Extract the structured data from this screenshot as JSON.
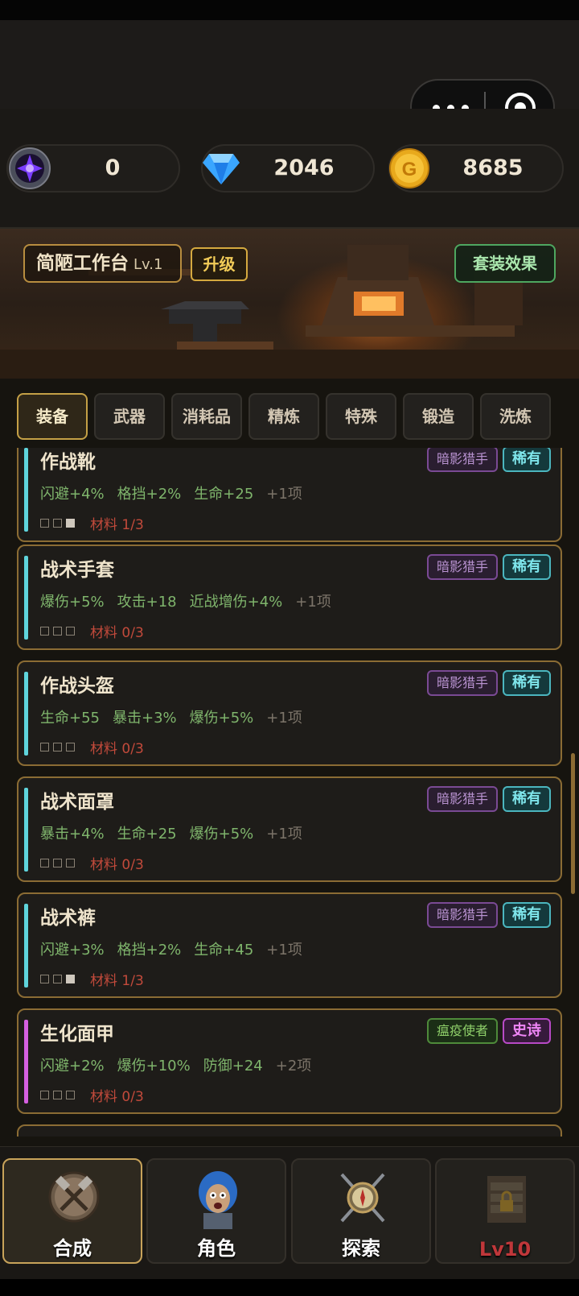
{
  "resources": [
    {
      "icon": "dark-crystal-icon",
      "value": "0"
    },
    {
      "icon": "diamond-icon",
      "value": "2046"
    },
    {
      "icon": "gold-coin-icon",
      "value": "8685"
    }
  ],
  "workbench": {
    "title": "简陋工作台",
    "level": "Lv.1",
    "upgrade": "升级",
    "set_effect": "套装效果"
  },
  "tabs": [
    "装备",
    "武器",
    "消耗品",
    "精炼",
    "特殊",
    "锻造",
    "洗炼"
  ],
  "items": [
    {
      "name": "作战靴",
      "stats": [
        "闪避+4%",
        "格挡+2%",
        "生命+25"
      ],
      "more": "+1项",
      "material": "材料 1/3",
      "filled": 1,
      "class": "暗影猎手",
      "rarity": "稀有"
    },
    {
      "name": "战术手套",
      "stats": [
        "爆伤+5%",
        "攻击+18",
        "近战增伤+4%"
      ],
      "more": "+1项",
      "material": "材料 0/3",
      "filled": 0,
      "class": "暗影猎手",
      "rarity": "稀有"
    },
    {
      "name": "作战头盔",
      "stats": [
        "生命+55",
        "暴击+3%",
        "爆伤+5%"
      ],
      "more": "+1项",
      "material": "材料 0/3",
      "filled": 0,
      "class": "暗影猎手",
      "rarity": "稀有"
    },
    {
      "name": "战术面罩",
      "stats": [
        "暴击+4%",
        "生命+25",
        "爆伤+5%"
      ],
      "more": "+1项",
      "material": "材料 0/3",
      "filled": 0,
      "class": "暗影猎手",
      "rarity": "稀有"
    },
    {
      "name": "战术裤",
      "stats": [
        "闪避+3%",
        "格挡+2%",
        "生命+45"
      ],
      "more": "+1项",
      "material": "材料 1/3",
      "filled": 1,
      "class": "暗影猎手",
      "rarity": "稀有"
    },
    {
      "name": "生化面甲",
      "stats": [
        "闪避+2%",
        "爆伤+10%",
        "防御+24"
      ],
      "more": "+2项",
      "material": "材料 0/3",
      "filled": 0,
      "class": "瘟疫使者",
      "rarity": "史诗"
    }
  ],
  "nav": [
    {
      "label": "合成",
      "icon": "crafting-tools-icon",
      "active": true
    },
    {
      "label": "角色",
      "icon": "character-portrait-icon",
      "active": false
    },
    {
      "label": "探索",
      "icon": "compass-swords-icon",
      "active": false
    },
    {
      "label": "Lv10",
      "icon": "locked-shop-icon",
      "active": false
    }
  ],
  "colors": {
    "rare": "#5fd4dc",
    "epic": "#d45fe0",
    "shadow_hunter": "#b07ad0",
    "plague": "#7fc05a",
    "frame_gold": "#8b6c34"
  }
}
